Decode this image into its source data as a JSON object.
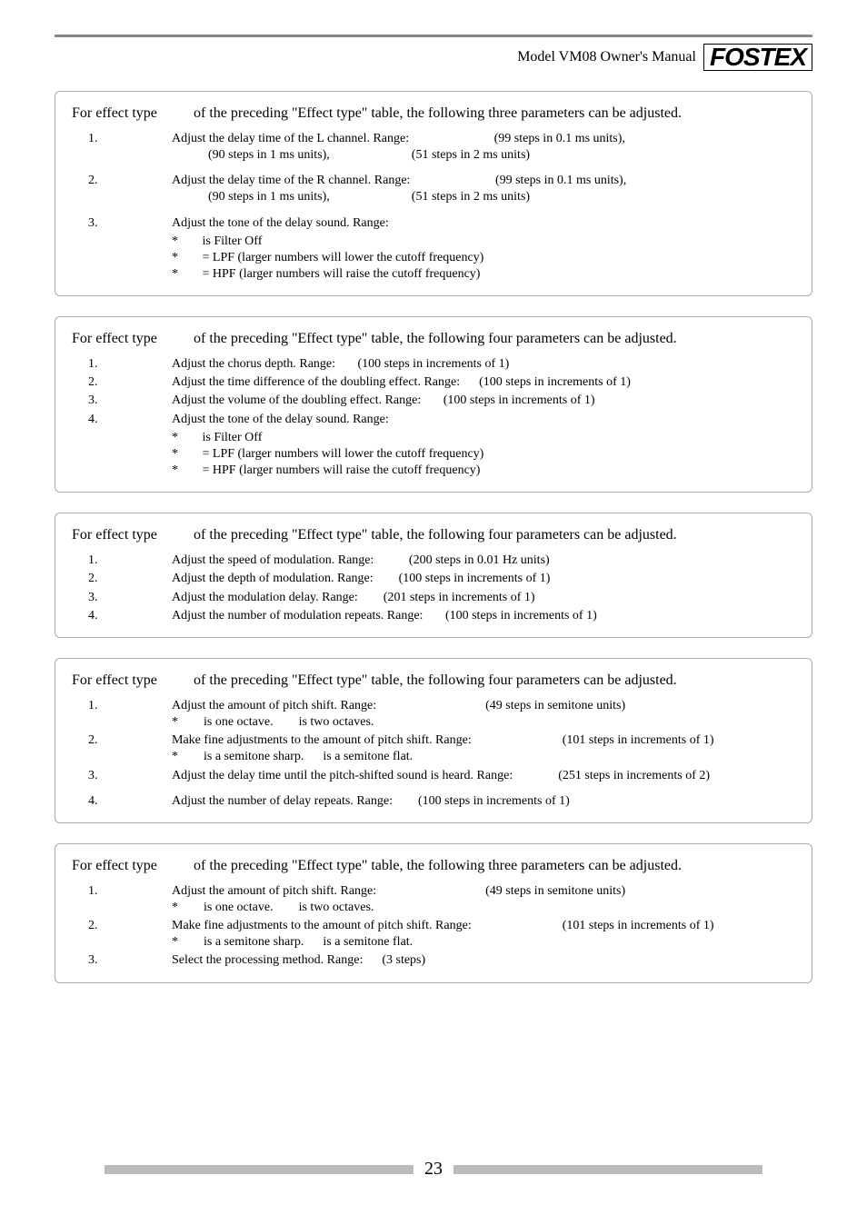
{
  "header": {
    "manual_title": "Model VM08 Owner's Manual",
    "brand": "FOSTEX"
  },
  "page_number": "23",
  "sections": [
    {
      "intro_lead": "For effect type",
      "intro_rest": "of the preceding \"Effect type\" table, the following three parameters can be adjusted.",
      "params": [
        {
          "num": "1.",
          "text_html": "Adjust the delay time of the L channel. Range: <span class=\"r3\">(99 steps in 0.1 ms units),</span><br><span style=\"margin-left:40px\">(90 steps in 1 ms units),</span><span class=\"r3\">(51 steps in 2 ms units)</span>"
        },
        {
          "num": "2.",
          "text_html": "Adjust the delay time of the R channel. Range: <span class=\"r3\">(99 steps in 0.1 ms units),</span><br><span style=\"margin-left:40px\">(90 steps in 1 ms units),</span><span class=\"r3\">(51 steps in 2 ms units)</span>"
        },
        {
          "num": "3.",
          "text_html": "Adjust the tone of the delay sound. Range:",
          "bullets": [
            " is Filter Off",
            " = LPF (larger numbers will lower the cutoff frequency)",
            " = HPF (larger numbers will raise the cutoff frequency)"
          ]
        }
      ]
    },
    {
      "intro_lead": "For effect type",
      "intro_rest": "of the preceding \"Effect type\" table, the following four parameters can be adjusted.",
      "params": [
        {
          "num": "1.",
          "text_html": "Adjust the chorus depth. Range:&nbsp;&nbsp;&nbsp;&nbsp;&nbsp;&nbsp;&nbsp;(100 steps in increments of 1)"
        },
        {
          "num": "2.",
          "text_html": "Adjust the time difference of the doubling effect. Range:&nbsp;&nbsp;&nbsp;&nbsp;&nbsp;&nbsp;(100 steps in increments of 1)"
        },
        {
          "num": "3.",
          "text_html": "Adjust the volume of the doubling effect. Range:&nbsp;&nbsp;&nbsp;&nbsp;&nbsp;&nbsp;&nbsp;(100 steps in increments of 1)"
        },
        {
          "num": "4.",
          "text_html": "Adjust the tone of the delay sound. Range:",
          "bullets": [
            " is Filter Off",
            " = LPF (larger numbers will lower the cutoff frequency)",
            " = HPF (larger numbers will raise the cutoff frequency)"
          ]
        }
      ]
    },
    {
      "intro_lead": "For effect type",
      "intro_rest": "of the preceding \"Effect type\" table, the following four parameters can be adjusted.",
      "params": [
        {
          "num": "1.",
          "text_html": "Adjust the speed of modulation. Range:&nbsp;&nbsp;&nbsp;&nbsp;&nbsp;&nbsp;&nbsp;&nbsp;&nbsp;&nbsp;&nbsp;(200 steps in 0.01 Hz units)"
        },
        {
          "num": "2.",
          "text_html": "Adjust the depth of modulation. Range:&nbsp;&nbsp;&nbsp;&nbsp;&nbsp;&nbsp;&nbsp;&nbsp;(100 steps in increments of 1)"
        },
        {
          "num": "3.",
          "text_html": "Adjust the modulation delay. Range:&nbsp;&nbsp;&nbsp;&nbsp;&nbsp;&nbsp;&nbsp;&nbsp;(201 steps in increments of 1)"
        },
        {
          "num": "4.",
          "text_html": "Adjust the number of modulation repeats. Range:&nbsp;&nbsp;&nbsp;&nbsp;&nbsp;&nbsp;&nbsp;(100 steps in increments of 1)"
        }
      ]
    },
    {
      "intro_lead": "For effect type",
      "intro_rest": "of the preceding \"Effect type\" table, the following four parameters can be adjusted.",
      "params": [
        {
          "num": "1.",
          "text_html": "Adjust the amount of pitch shift. Range:<span style=\"margin-left:120px\">(49 steps in semitone units)</span><br>*&nbsp;&nbsp;&nbsp;&nbsp;&nbsp;&nbsp;&nbsp; is one octave.&nbsp;&nbsp;&nbsp;&nbsp;&nbsp;&nbsp;&nbsp; is two octaves."
        },
        {
          "num": "2.",
          "text_html": "Make fine adjustments to the amount of pitch shift. Range:<span style=\"margin-left:100px\">(101 steps in</span> increments of 1)<br>*&nbsp;&nbsp;&nbsp;&nbsp;&nbsp;&nbsp;&nbsp; is a semitone sharp.&nbsp;&nbsp;&nbsp;&nbsp;&nbsp; is a semitone flat."
        },
        {
          "num": "3.",
          "text_html": "Adjust the delay time until the pitch-shifted sound is heard. Range:<span style=\"margin-left:50px\">(251 steps in</span> increments of 2)"
        },
        {
          "num": "4.",
          "text_html": "Adjust the number of delay repeats. Range:&nbsp;&nbsp;&nbsp;&nbsp;&nbsp;&nbsp;&nbsp;&nbsp;(100 steps in increments of 1)"
        }
      ]
    },
    {
      "intro_lead": "For effect type",
      "intro_rest": "of the preceding \"Effect type\" table, the following three parameters can be adjusted.",
      "params": [
        {
          "num": "1.",
          "text_html": "Adjust the amount of pitch shift. Range:<span style=\"margin-left:120px\">(49 steps in semitone units)</span><br>*&nbsp;&nbsp;&nbsp;&nbsp;&nbsp;&nbsp;&nbsp; is one octave.&nbsp;&nbsp;&nbsp;&nbsp;&nbsp;&nbsp;&nbsp; is two octaves."
        },
        {
          "num": "2.",
          "text_html": "Make fine adjustments to the amount of pitch shift. Range:<span style=\"margin-left:100px\">(101 steps in</span> increments of 1)<br>*&nbsp;&nbsp;&nbsp;&nbsp;&nbsp;&nbsp;&nbsp; is a semitone sharp.&nbsp;&nbsp;&nbsp;&nbsp;&nbsp; is a semitone flat."
        },
        {
          "num": "3.",
          "text_html": "Select the processing method. Range:&nbsp;&nbsp;&nbsp;&nbsp;&nbsp;&nbsp;(3 steps)"
        }
      ]
    }
  ]
}
